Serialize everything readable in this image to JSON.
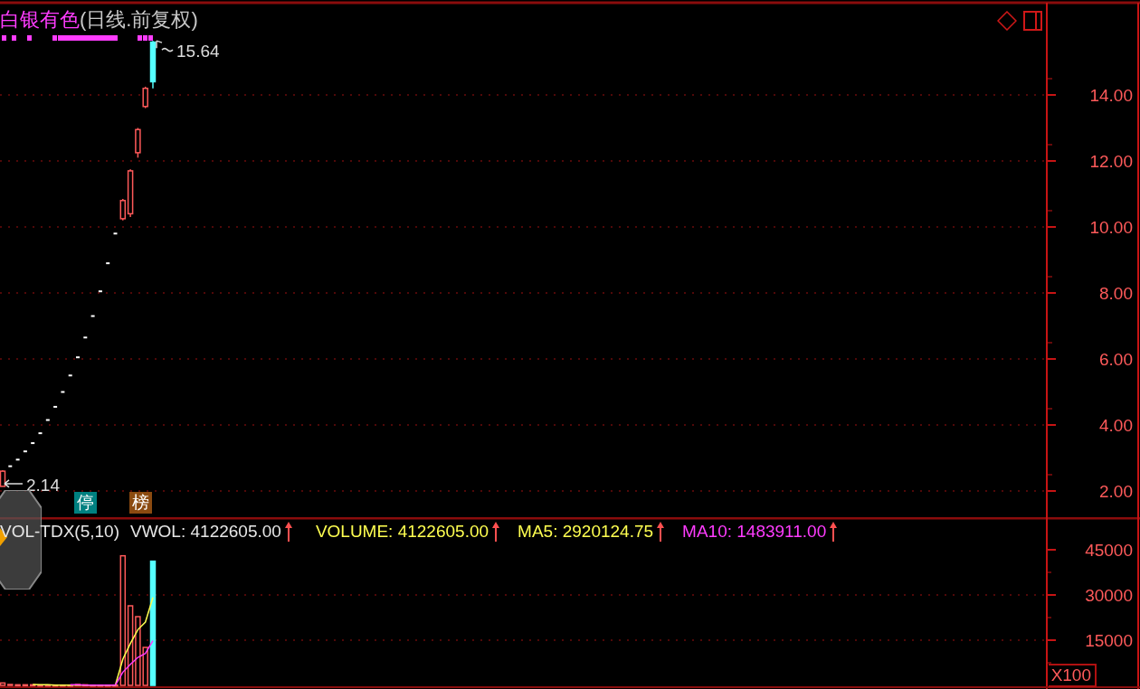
{
  "title": {
    "name": "白银有色",
    "period": "(日线.前复权)"
  },
  "price_chart": {
    "axis_labels": [
      "14.00",
      "12.00",
      "10.00",
      "8.00",
      "6.00",
      "4.00",
      "2.00"
    ],
    "high_label": "15.64",
    "low_label": "2.14",
    "badges": [
      {
        "text": "停",
        "color": "#008080"
      },
      {
        "text": "榜",
        "color": "#8b4a10"
      }
    ]
  },
  "volume": {
    "indicator": "VOL-TDX(5,10)",
    "readings": [
      {
        "label": "VWOL: 4122605.00",
        "color": "#e6e6e6"
      },
      {
        "label": "VOLUME: 4122605.00",
        "color": "#ffff50"
      },
      {
        "label": "MA5: 2920124.75",
        "color": "#ffff50"
      },
      {
        "label": "MA10: 1483911.00",
        "color": "#ff3cff"
      }
    ],
    "axis_labels": [
      "45000",
      "30000",
      "15000"
    ],
    "multiplier": "X100"
  }
}
